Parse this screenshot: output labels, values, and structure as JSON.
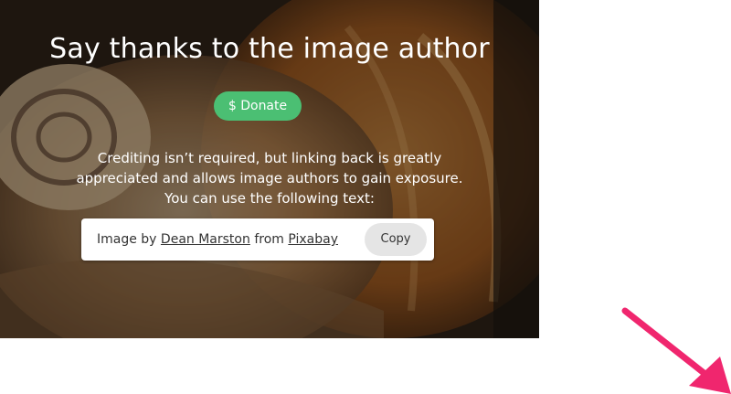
{
  "banner": {
    "title": "Say thanks to the image author",
    "donate_label": "$ Donate",
    "description_lines": [
      "Crediting isn’t required, but linking back is greatly",
      "appreciated and allows image authors to gain exposure.",
      "You can use the following text:"
    ],
    "credit": {
      "prefix": "Image by",
      "author": "Dean Marston",
      "middle": "from",
      "site": "Pixabay",
      "copy_label": "Copy"
    }
  },
  "colors": {
    "donate": "#4bbf73",
    "arrow": "#f0266e",
    "copy_button": "#e5e5e5"
  },
  "icons": {
    "annotation": "pointer-arrow-icon"
  }
}
